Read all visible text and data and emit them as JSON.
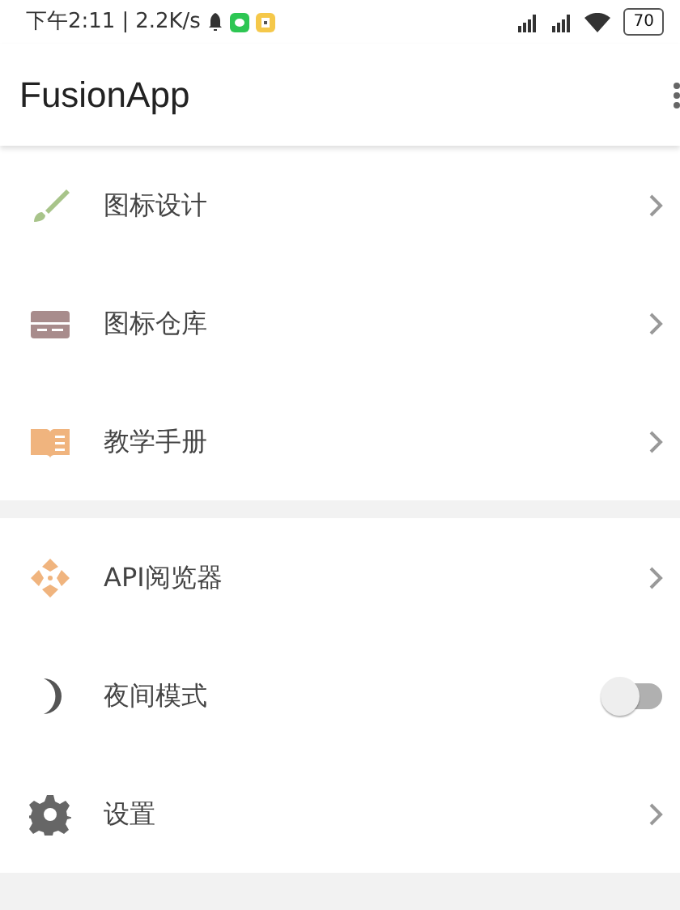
{
  "status_bar": {
    "time": "下午2:11",
    "separator": "|",
    "speed": "2.2K/s",
    "battery": "70"
  },
  "app_bar": {
    "title": "FusionApp"
  },
  "groups": [
    {
      "items": [
        {
          "label": "图标设计",
          "kind": "link"
        },
        {
          "label": "图标仓库",
          "kind": "link"
        },
        {
          "label": "教学手册",
          "kind": "link"
        }
      ]
    },
    {
      "items": [
        {
          "label": "API阅览器",
          "kind": "link"
        },
        {
          "label": "夜间模式",
          "kind": "toggle",
          "on": false
        },
        {
          "label": "设置",
          "kind": "link"
        }
      ]
    }
  ]
}
